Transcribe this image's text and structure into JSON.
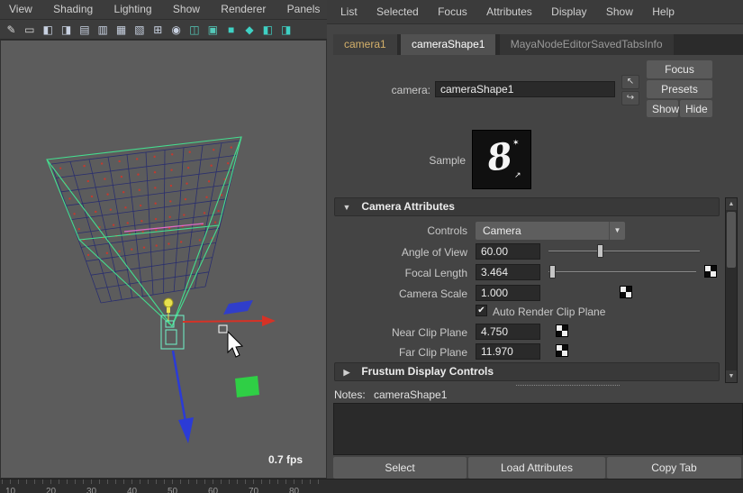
{
  "viewport": {
    "menu": [
      "View",
      "Shading",
      "Lighting",
      "Show",
      "Renderer",
      "Panels"
    ],
    "toolbar_icons": [
      "✎",
      "▭",
      "◧",
      "◨",
      "▤",
      "▥",
      "▦",
      "▧",
      "⊞",
      "◉",
      "◫",
      "▣",
      "■",
      "◆",
      "◧",
      "◨"
    ],
    "fps": "0.7 fps",
    "timeline_ticks": [
      "10",
      "20",
      "30",
      "40",
      "50",
      "60",
      "70",
      "80"
    ]
  },
  "attribute_editor": {
    "menu": [
      "List",
      "Selected",
      "Focus",
      "Attributes",
      "Display",
      "Show",
      "Help"
    ],
    "tabs": [
      {
        "label": "camera1"
      },
      {
        "label": "cameraShape1"
      },
      {
        "label": "MayaNodeEditorSavedTabsInfo"
      }
    ],
    "camera": {
      "label": "camera:",
      "value": "cameraShape1"
    },
    "buttons": {
      "focus": "Focus",
      "presets": "Presets",
      "show": "Show",
      "hide": "Hide"
    },
    "sample_label": "Sample",
    "camera_attributes": {
      "title": "Camera Attributes",
      "controls_label": "Controls",
      "controls_value": "Camera",
      "angle_of_view_label": "Angle of View",
      "angle_of_view_value": "60.00",
      "focal_length_label": "Focal Length",
      "focal_length_value": "3.464",
      "camera_scale_label": "Camera Scale",
      "camera_scale_value": "1.000",
      "auto_render_clip_label": "Auto Render Clip Plane",
      "auto_render_clip_checked": true,
      "near_clip_label": "Near Clip Plane",
      "near_clip_value": "4.750",
      "far_clip_label": "Far Clip Plane",
      "far_clip_value": "11.970"
    },
    "frustum_section_title": "Frustum Display Controls",
    "notes": {
      "label": "Notes:",
      "value": "cameraShape1"
    },
    "footer_buttons": [
      "Select",
      "Load Attributes",
      "Copy Tab"
    ]
  },
  "icons": {
    "section_open": "▼",
    "section_closed": "▶",
    "dropdown_arrow": "▼",
    "scroll_up": "▲",
    "scroll_down": "▼",
    "checkmark": "✔",
    "load_node_arrow": "↖",
    "pin_node_arrow": "↪"
  },
  "scene": {
    "colors": {
      "grid_line": "#2a2f6e",
      "particle_dot": "#c23a30",
      "frustum_green": "#45dd8f",
      "camera_outline": "#6fe8c0",
      "axis_x_red": "#d63226",
      "axis_blue": "#2b3bd6",
      "light_yellow": "#e8e04e",
      "selected_object_green": "#2fcf45",
      "component_pink": "#e06ac8"
    }
  }
}
